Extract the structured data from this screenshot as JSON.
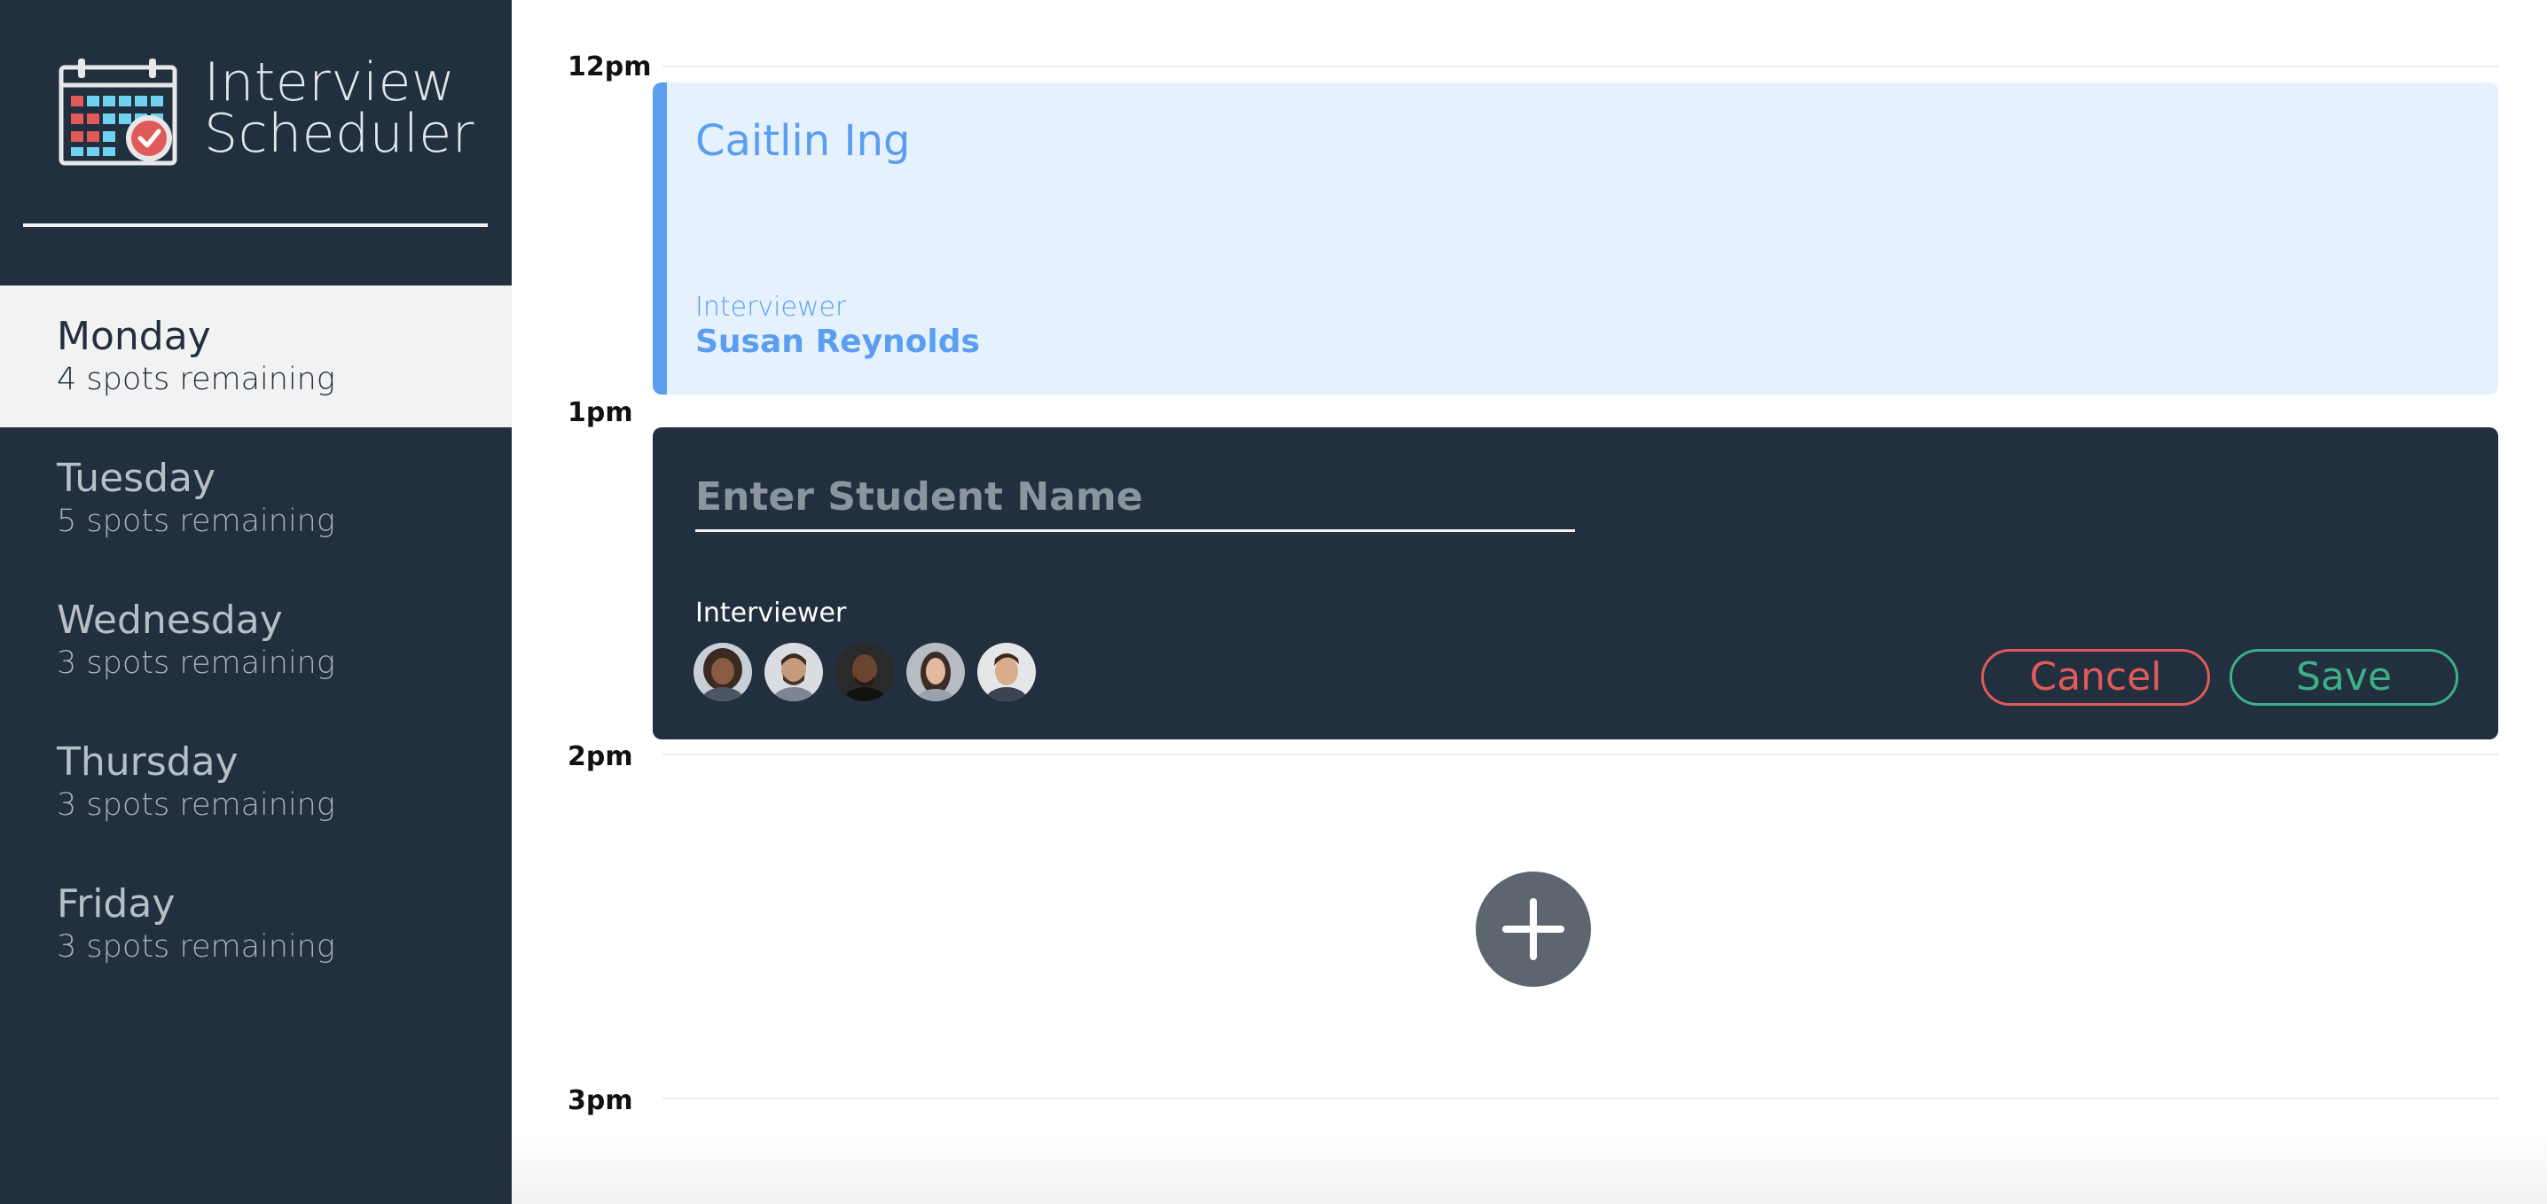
{
  "app": {
    "title_line1": "Interview",
    "title_line2": "Scheduler",
    "logo_icon": "calendar-check-icon"
  },
  "days": [
    {
      "name": "Monday",
      "spots": "4 spots remaining",
      "selected": true
    },
    {
      "name": "Tuesday",
      "spots": "5 spots remaining",
      "selected": false
    },
    {
      "name": "Wednesday",
      "spots": "3 spots remaining",
      "selected": false
    },
    {
      "name": "Thursday",
      "spots": "3 spots remaining",
      "selected": false
    },
    {
      "name": "Friday",
      "spots": "3 spots remaining",
      "selected": false
    }
  ],
  "times": [
    "12pm",
    "1pm",
    "2pm",
    "3pm"
  ],
  "appointment": {
    "student": "Caitlin Ing",
    "interviewer_label": "Interviewer",
    "interviewer_name": "Susan Reynolds"
  },
  "form": {
    "placeholder": "Enter Student Name",
    "value": "",
    "interviewer_label": "Interviewer",
    "interviewer_avatars": [
      "avatar-1",
      "avatar-2",
      "avatar-3",
      "avatar-4",
      "avatar-5"
    ],
    "cancel_label": "Cancel",
    "save_label": "Save"
  },
  "add_button_icon": "plus-icon",
  "colors": {
    "sidebar_bg": "#222f3e",
    "selected_day_bg": "#f2f2f2",
    "appointment_bg": "#e6f1fe",
    "appointment_accent": "#5b9ef0",
    "cancel": "#e05a5a",
    "save": "#3db087",
    "add_button": "#5d6670"
  }
}
